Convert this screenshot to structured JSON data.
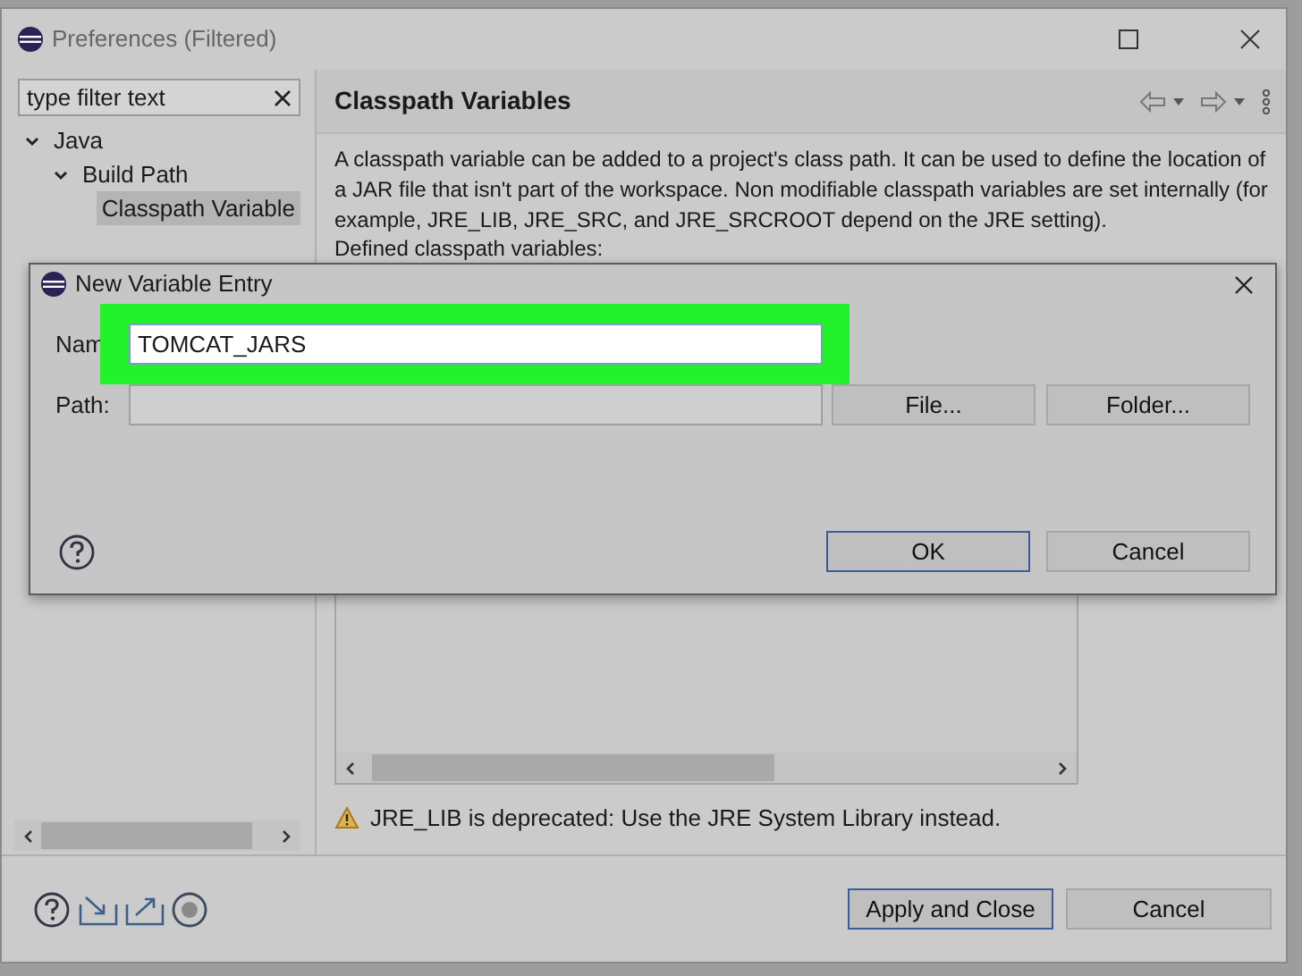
{
  "window": {
    "title": "Preferences (Filtered)"
  },
  "filter": {
    "value": "type filter text"
  },
  "tree": [
    {
      "label": "Java",
      "expanded": true,
      "selected": false,
      "children": [
        {
          "label": "Build Path",
          "expanded": true,
          "selected": false,
          "children": [
            {
              "label": "Classpath Variable",
              "selected": true
            }
          ]
        }
      ]
    }
  ],
  "page": {
    "title": "Classpath Variables",
    "description": "A classpath variable can be added to a project's class path. It can be used to define the location of a JAR file that isn't part of the workspace. Non modifiable classpath variables are set internally (for example, JRE_LIB, JRE_SRC, and JRE_SRCROOT depend on the JRE setting).",
    "list_label": "Defined classpath variables:",
    "warning": "JRE_LIB is deprecated: Use the JRE System Library instead."
  },
  "footer_buttons": [
    {
      "label": "Apply and Close",
      "default": true
    },
    {
      "label": "Cancel",
      "default": false
    }
  ],
  "dialog": {
    "title": "New Variable Entry",
    "name_field": {
      "label": "Nam",
      "value": "TOMCAT_JARS",
      "highlighted": true
    },
    "path_field": {
      "label": "Path:"
    },
    "path_buttons": [
      {
        "label": "File..."
      },
      {
        "label": "Folder..."
      }
    ],
    "actions": [
      {
        "label": "OK",
        "default": true
      },
      {
        "label": "Cancel",
        "default": false
      }
    ]
  }
}
